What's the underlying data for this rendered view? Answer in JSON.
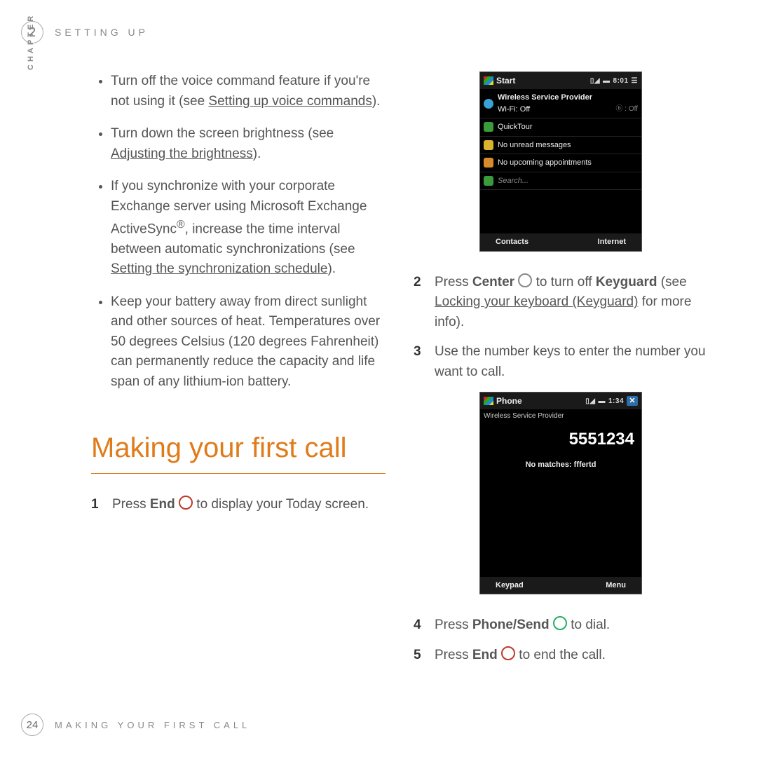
{
  "header": {
    "chapter_badge": "2",
    "section": "SETTING UP",
    "sidebar_label": "CHAPTER"
  },
  "left": {
    "bullets": {
      "b1a": "Turn off the voice command feature if you're not using it (see ",
      "b1link": "Setting up voice commands",
      "b1b": ").",
      "b2a": "Turn down the screen brightness (see ",
      "b2link": "Adjusting the brightness",
      "b2b": ").",
      "b3a": "If you synchronize with your corporate Exchange server using Microsoft Exchange ActiveSync",
      "b3sup": "®",
      "b3b": ", increase the time interval between automatic synchronizations (see ",
      "b3link": "Setting the synchronization schedule",
      "b3c": ").",
      "b4": "Keep your battery away from direct sunlight and other sources of heat. Temperatures over 50 degrees Celsius (120 degrees Fahrenheit) can permanently reduce the capacity and life span of any lithium-ion battery."
    },
    "section_title": "Making your first call",
    "step1": {
      "num": "1",
      "a": "Press ",
      "end": "End",
      "b": " to display your Today screen."
    }
  },
  "right": {
    "today": {
      "title": "Start",
      "time": "8:01",
      "provider": "Wireless Service Provider",
      "wifi": "Wi-Fi: Off",
      "bt": ": Off",
      "quick": "QuickTour",
      "msgs": "No unread messages",
      "appts": "No upcoming appointments",
      "search_placeholder": "Search...",
      "sk_left": "Contacts",
      "sk_right": "Internet"
    },
    "step2": {
      "num": "2",
      "a": "Press ",
      "center": "Center",
      "b": " to turn off ",
      "keyguard": "Keyguard",
      "c": " (see ",
      "link": "Locking your keyboard (Keyguard)",
      "d": " for more info)."
    },
    "step3": {
      "num": "3",
      "txt": "Use the number keys to enter the number you want to call."
    },
    "phone": {
      "title": "Phone",
      "time": "1:34",
      "provider": "Wireless Service Provider",
      "number": "5551234",
      "nomatch": "No matches: fffertd",
      "sk_left": "Keypad",
      "sk_right": "Menu"
    },
    "step4": {
      "num": "4",
      "a": "Press ",
      "phonesend": "Phone/Send",
      "b": " to dial."
    },
    "step5": {
      "num": "5",
      "a": "Press ",
      "end": "End",
      "b": " to end the call."
    }
  },
  "footer": {
    "page_number": "24",
    "title": "MAKING YOUR FIRST CALL"
  }
}
